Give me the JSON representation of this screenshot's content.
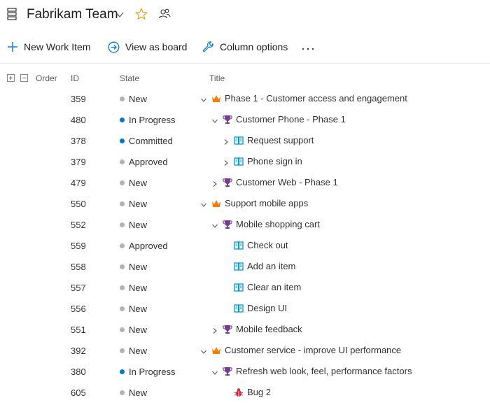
{
  "header": {
    "team_name": "Fabrikam Team"
  },
  "toolbar": {
    "new_item": "New Work Item",
    "view_board": "View as board",
    "column_options": "Column options",
    "more": "···"
  },
  "columns": {
    "order": "Order",
    "id": "ID",
    "state": "State",
    "title": "Title"
  },
  "colors": {
    "new": "#b2b2b2",
    "active": "#007acc",
    "epic": "#ff7b00",
    "feature": "#773b93",
    "story": "#009ccc",
    "bug": "#cc293d"
  },
  "rows": [
    {
      "id": "359",
      "state": "New",
      "title": "Phase 1 - Customer access and engagement"
    },
    {
      "id": "480",
      "state": "In Progress",
      "title": "Customer Phone - Phase 1"
    },
    {
      "id": "378",
      "state": "Committed",
      "title": "Request support"
    },
    {
      "id": "379",
      "state": "Approved",
      "title": "Phone sign in"
    },
    {
      "id": "479",
      "state": "New",
      "title": "Customer Web - Phase 1"
    },
    {
      "id": "550",
      "state": "New",
      "title": "Support mobile apps"
    },
    {
      "id": "552",
      "state": "New",
      "title": "Mobile shopping cart"
    },
    {
      "id": "559",
      "state": "Approved",
      "title": "Check out"
    },
    {
      "id": "558",
      "state": "New",
      "title": "Add an item"
    },
    {
      "id": "557",
      "state": "New",
      "title": "Clear an item"
    },
    {
      "id": "556",
      "state": "New",
      "title": "Design UI"
    },
    {
      "id": "551",
      "state": "New",
      "title": "Mobile feedback"
    },
    {
      "id": "392",
      "state": "New",
      "title": "Customer service - improve UI performance"
    },
    {
      "id": "380",
      "state": "In Progress",
      "title": "Refresh web look, feel, performance factors"
    },
    {
      "id": "605",
      "state": "New",
      "title": "Bug 2"
    }
  ]
}
